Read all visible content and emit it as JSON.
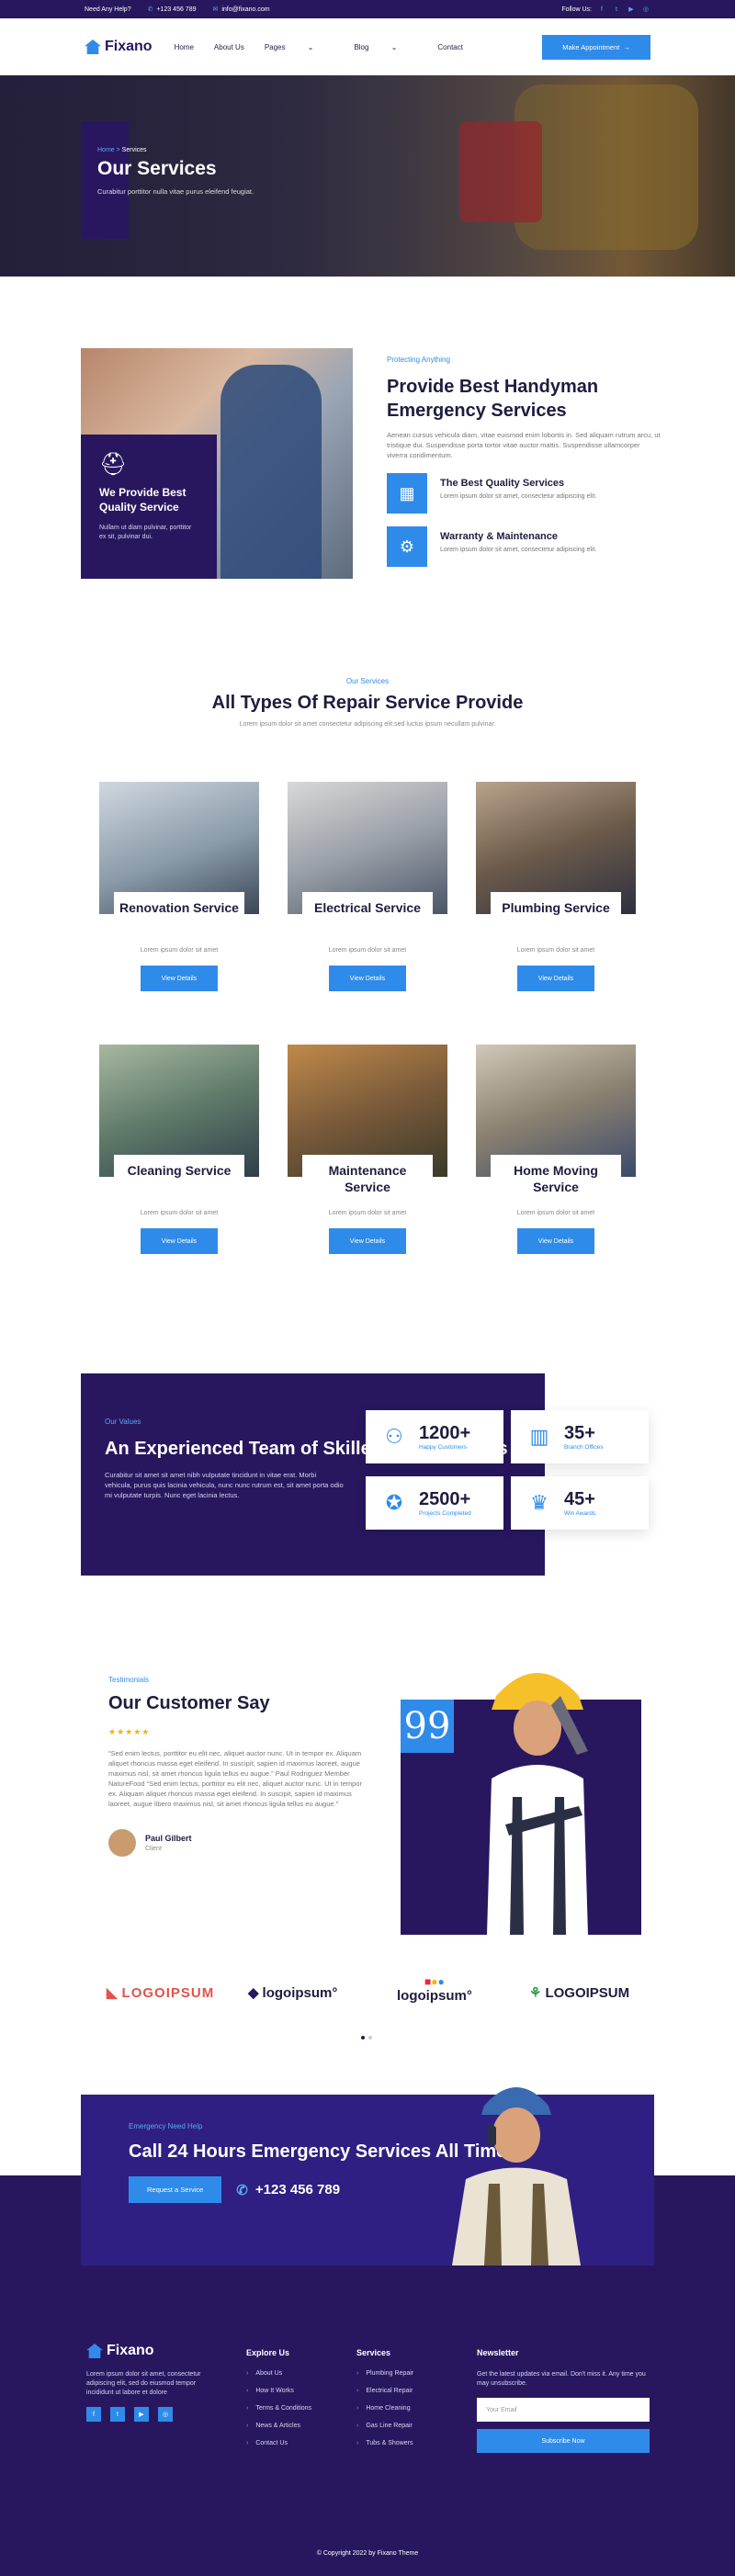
{
  "topbar": {
    "help": "Need Any Help?",
    "phone": "+123 456 789",
    "email": "info@fixano.com",
    "follow": "Follow Us:"
  },
  "nav": {
    "brand": "Fixano",
    "items": [
      "Home",
      "About Us",
      "Pages",
      "Blog",
      "Contact"
    ],
    "cta": "Make Appointment"
  },
  "hero": {
    "crumb_home": "Home",
    "crumb_sep": " > ",
    "crumb_current": "Services",
    "title": "Our Services",
    "subtitle": "Curabitur porttitor nulla vitae purus eleifend feugiat."
  },
  "about": {
    "card_title": "We Provide Best Quality Service",
    "card_text": "Nullam ut diam pulvinar, porttitor ex sit, pulvinar dui.",
    "eyebrow": "Protecting Anything",
    "title": "Provide Best Handyman Emergency Services",
    "desc": "Aenean cursus vehicula diam, vitae euismod enim lobortis in. Sed aliquam rutrum arcu, ut tristique dui. Suspendisse porta tortor vitae auctor mattis. Suspendisse ullamcorper viverra condimentum.",
    "features": [
      {
        "title": "The Best Quality Services",
        "text": "Lorem ipsum dolor sit amet, consectetur adipiscing elit."
      },
      {
        "title": "Warranty & Maintenance",
        "text": "Lorem ipsum dolor sit amet, consectetur adipiscing elit."
      }
    ]
  },
  "services": {
    "eyebrow": "Our Services",
    "title": "All Types Of Repair Service Provide",
    "subtitle": "Lorem ipsum dolor sit amet consectetur adipiscing elit.sed luctus ipsum necullam pulvinar.",
    "items": [
      {
        "title": "Renovation Service",
        "desc": "Lorem ipsum dolor sit amet",
        "btn": "View Details"
      },
      {
        "title": "Electrical Service",
        "desc": "Lorem ipsum dolor sit amet",
        "btn": "View Details"
      },
      {
        "title": "Plumbing Service",
        "desc": "Lorem ipsum dolor sit amet",
        "btn": "View Details"
      },
      {
        "title": "Cleaning Service",
        "desc": "Lorem ipsum dolor sit amet",
        "btn": "View Details"
      },
      {
        "title": "Maintenance Service",
        "desc": "Lorem ipsum dolor sit amet",
        "btn": "View Details"
      },
      {
        "title": "Home Moving Service",
        "desc": "Lorem ipsum dolor sit amet",
        "btn": "View Details"
      }
    ]
  },
  "values": {
    "eyebrow": "Our Values",
    "title": "An Experienced Team of Skilled Professionals",
    "text": "Curabitur sit amet sit amet nibh vulputate tincidunt in vitae erat. Morbi vehicula, purus quis lacinia vehicula, nunc nunc rutrum est, sit amet porta odio mi vulputate turpis. Nunc eget lacinia lectus.",
    "stats": [
      {
        "num": "1200+",
        "label": "Happy Customers"
      },
      {
        "num": "35+",
        "label": "Branch Offices"
      },
      {
        "num": "2500+",
        "label": "Projects Completed"
      },
      {
        "num": "45+",
        "label": "Win Awards"
      }
    ]
  },
  "testimonials": {
    "eyebrow": "Testimonials",
    "title": "Our Customer Say",
    "stars": "★★★★★",
    "quote": "“Sed enim lectus, porttitor eu elit nec, aliquet auctor nunc. Ut in tempor ex. Aliquam aliquet rhoncus massa eget eleifend. In suscipit, sapien id maximus laoreet, augue maximus nisl, sit amet rhoncus ligula tellus eu augue.” Paul Rodriguez Member NatureFood “Sed enim lectus, porttitor eu elit nec, aliquet auctor nunc. Ut in tempor ex. Aliquam aliquet rhoncus massa eget eleifend. In suscipit, sapien id maximus laoreet, augue libero maximus nisl, sit amet rhoncus ligula tellus eu augue.”",
    "author": "Paul Gilbert",
    "role": "Client",
    "qmark": "99"
  },
  "logos": [
    "LOGOIPSUM",
    "logoipsum°",
    "logoipsum°",
    "LOGOIPSUM"
  ],
  "emergency": {
    "eyebrow": "Emergency Need Help",
    "title": "Call 24 Hours Emergency Services All Time!",
    "button": "Request a Service",
    "phone": "+123 456 789"
  },
  "footer": {
    "brand": "Fixano",
    "desc": "Lorem ipsum dolor sit amet, consectetur adipiscing elit, sed do eiusmod tempor incididunt ut labore et dolore",
    "explore_title": "Explore Us",
    "explore": [
      "About Us",
      "How It Works",
      "Terms & Conditions",
      "News & Articles",
      "Contact Us"
    ],
    "services_title": "Services",
    "services": [
      "Plumbing Repair",
      "Electrical Repair",
      "Home Cleaning",
      "Gas Line Repair",
      "Tubs & Showers"
    ],
    "newsletter_title": "Newsletter",
    "newsletter_text": "Get the latest updates via email. Don't miss it. Any time you may unsubscribe.",
    "email_placeholder": "Your Email",
    "subscribe": "Subscribe Now",
    "copyright": "© Copyright 2022 by Fixano Theme"
  },
  "colors": {
    "primary": "#28175f",
    "accent": "#2f8bea",
    "star": "#f4b400"
  }
}
